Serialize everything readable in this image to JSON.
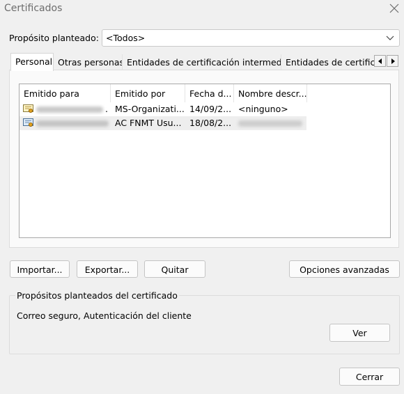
{
  "window": {
    "title": "Certificados"
  },
  "purpose": {
    "label": "Propósito planteado:",
    "value": "<Todos>"
  },
  "tabs": [
    {
      "label": "Personal"
    },
    {
      "label": "Otras personas"
    },
    {
      "label": "Entidades de certificación intermedias"
    },
    {
      "label": "Entidades de certificación raíz de confianza"
    }
  ],
  "table": {
    "columns": [
      "Emitido para",
      "Emitido por",
      "Fecha d...",
      "Nombre descr..."
    ],
    "rows": [
      {
        "issued_by": "MS-Organizati...",
        "date": "14/09/2...",
        "friendly_name": "<ninguno>",
        "trailing": "."
      },
      {
        "issued_by": "AC FNMT Usu...",
        "date": "18/08/2...",
        "friendly_name": ""
      }
    ]
  },
  "buttons": {
    "import": "Importar...",
    "export": "Exportar...",
    "remove": "Quitar",
    "advanced": "Opciones avanzadas",
    "view": "Ver",
    "close": "Cerrar"
  },
  "purposes_group": {
    "title": "Propósitos planteados del certificado",
    "text": "Correo seguro, Autenticación del cliente"
  },
  "colors": {
    "background": "#f0f0f0",
    "list_bg": "#ffffff",
    "selected_row": "#eeeeee"
  },
  "icons": [
    "close-icon",
    "chevron-down-icon",
    "arrow-left-icon",
    "arrow-right-icon",
    "certificate-icon"
  ]
}
